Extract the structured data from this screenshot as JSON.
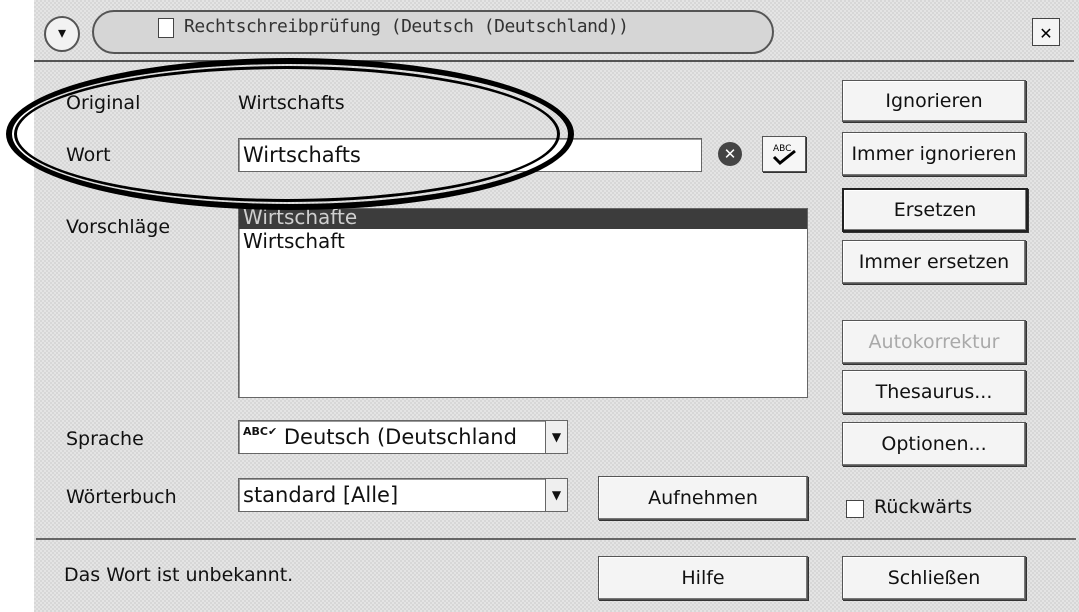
{
  "window": {
    "title": "Rechtschreibprüfung (Deutsch (Deutschland))",
    "close_symbol": "✕",
    "menu_symbol": "▾"
  },
  "labels": {
    "original": "Original",
    "original_value": "Wirtschafts",
    "wort": "Wort",
    "vorschlaege": "Vorschläge",
    "sprache": "Sprache",
    "woerterbuch": "Wörterbuch"
  },
  "word_input": {
    "value": "Wirtschafts"
  },
  "suggestions": [
    {
      "text": "Wirtschafte",
      "selected": true
    },
    {
      "text": "Wirtschaft",
      "selected": false
    }
  ],
  "language_select": {
    "value": "Deutsch (Deutschland",
    "icon": "ABC✔"
  },
  "dictionary_select": {
    "value": "standard [Alle]"
  },
  "buttons": {
    "ignorieren": "Ignorieren",
    "immer_ignorieren": "Immer ignorieren",
    "ersetzen": "Ersetzen",
    "immer_ersetzen": "Immer ersetzen",
    "autokorrektur": "Autokorrektur",
    "thesaurus": "Thesaurus...",
    "optionen": "Optionen...",
    "aufnehmen": "Aufnehmen",
    "hilfe": "Hilfe",
    "schliessen": "Schließen"
  },
  "checkbox": {
    "label": "Rückwärts",
    "checked": false
  },
  "status": "Das Wort ist unbekannt.",
  "icons": {
    "clear": "clear-icon",
    "spellcheck": "spellcheck-icon"
  }
}
